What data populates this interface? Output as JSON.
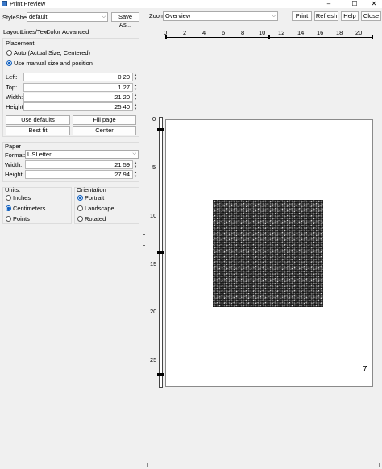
{
  "window": {
    "title": "Print Preview",
    "minimize": "–",
    "maximize": "☐",
    "close": "✕"
  },
  "toolbar": {
    "stylesheet_label": "StyleSheet",
    "stylesheet_value": "default",
    "save_as": "Save As...",
    "zoom_label": "Zoom",
    "zoom_value": "Overview",
    "print": "Print",
    "refresh": "Refresh",
    "help": "Help",
    "close": "Close"
  },
  "tabs": [
    "Layout",
    "Lines/Text",
    "Color",
    "Advanced"
  ],
  "placement": {
    "title": "Placement",
    "auto_label": "Auto (Actual Size, Centered)",
    "manual_label": "Use manual size and position",
    "selected": "manual",
    "fields": [
      {
        "label": "Left:",
        "value": "0.20"
      },
      {
        "label": "Top:",
        "value": "1.27"
      },
      {
        "label": "Width:",
        "value": "21.20"
      },
      {
        "label": "Height:",
        "value": "25.40"
      }
    ],
    "buttons": [
      "Use defaults",
      "Fill page",
      "Best fit",
      "Center"
    ]
  },
  "paper": {
    "title": "Paper",
    "format_label": "Format:",
    "format_value": "USLetter",
    "fields": [
      {
        "label": "Width:",
        "value": "21.59"
      },
      {
        "label": "Height:",
        "value": "27.94"
      }
    ]
  },
  "units": {
    "title": "Units:",
    "options": [
      "Inches",
      "Centimeters",
      "Points"
    ],
    "selected": "Centimeters"
  },
  "orientation": {
    "title": "Orientation",
    "options": [
      "Portrait",
      "Landscape",
      "Rotated"
    ],
    "selected": "Portrait"
  },
  "hruler_labels": [
    "0",
    "2",
    "4",
    "6",
    "8",
    "10",
    "12",
    "14",
    "16",
    "18",
    "20"
  ],
  "vruler_labels": [
    "0",
    "5",
    "10",
    "15",
    "20",
    "25"
  ],
  "page_number": "7",
  "spin_up": "▲",
  "spin_down": "▼",
  "dropdown_arrow": "⌵"
}
